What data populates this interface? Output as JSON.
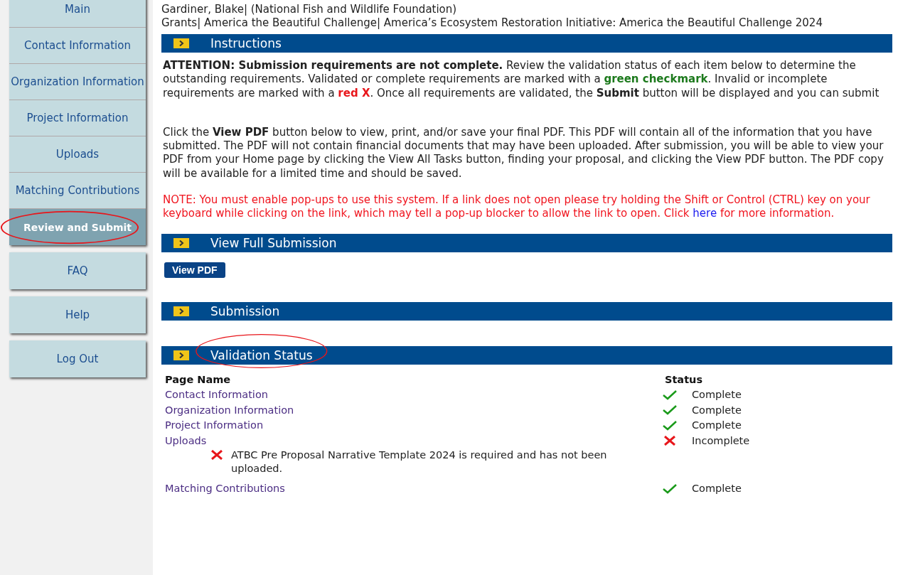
{
  "sidebar": {
    "groups": [
      {
        "items": [
          {
            "label": "Main",
            "selected": false,
            "circled": false
          },
          {
            "label": "Contact Information",
            "selected": false,
            "circled": false
          },
          {
            "label": "Organization Information",
            "selected": false,
            "circled": false
          },
          {
            "label": "Project Information",
            "selected": false,
            "circled": false
          },
          {
            "label": "Uploads",
            "selected": false,
            "circled": false
          },
          {
            "label": "Matching Contributions",
            "selected": false,
            "circled": false
          },
          {
            "label": "Review and Submit",
            "selected": true,
            "circled": true
          }
        ]
      },
      {
        "items": [
          {
            "label": "FAQ",
            "selected": false,
            "circled": false
          }
        ]
      },
      {
        "items": [
          {
            "label": "Help",
            "selected": false,
            "circled": false
          }
        ]
      },
      {
        "items": [
          {
            "label": "Log Out",
            "selected": false,
            "circled": false
          }
        ]
      }
    ]
  },
  "header_lines": [
    "Gardiner, Blake| (National Fish and Wildlife Foundation)",
    "Grants| America the Beautiful Challenge| America’s Ecosystem Restoration Initiative: America the Beautiful Challenge 2024"
  ],
  "sections": [
    {
      "title": "Instructions",
      "circled": false,
      "kind": "text",
      "paragraphs": [
        [
          {
            "kind": "bold",
            "text": "ATTENTION: Submission requirements are not complete."
          },
          {
            "kind": "text",
            "text": " Review the validation status of each item below to determine the outstanding requirements. Validated or complete requirements are marked with a "
          },
          {
            "kind": "green",
            "text": "green checkmark"
          },
          {
            "kind": "text",
            "text": ". Invalid or incomplete requirements are marked with a "
          },
          {
            "kind": "red",
            "text": "red X"
          },
          {
            "kind": "text",
            "text": ".  Once all requirements are validated, the "
          },
          {
            "kind": "bold",
            "text": "Submit"
          },
          {
            "kind": "text",
            "text": " button will be displayed and you can submit"
          }
        ],
        [
          {
            "kind": "text",
            "text": "Click the "
          },
          {
            "kind": "bold",
            "text": "View PDF"
          },
          {
            "kind": "text",
            "text": " button below to view, print, and/or save your final PDF. This PDF will contain all of the information that you have submitted. The PDF will not contain financial documents that may have been uploaded. After submission, you will be able to view your PDF from your Home page by clicking the View All Tasks button, finding your proposal, and clicking the View PDF button. The PDF copy will be available for a limited time and should be saved."
          }
        ],
        [
          {
            "kind": "warn",
            "text": "NOTE: You must enable pop-ups to use this system. If a link does not open please try holding the Shift or Control (CTRL) key on your keyboard while clicking on the link, which may tell a pop-up blocker to allow the link to open. Click "
          },
          {
            "kind": "link",
            "text": "here"
          },
          {
            "kind": "warn",
            "text": " for more information."
          }
        ]
      ]
    },
    {
      "title": "View Full Submission",
      "circled": false,
      "kind": "button",
      "button": "View PDF"
    },
    {
      "title": "Submission",
      "circled": false,
      "kind": "empty"
    },
    {
      "title": "Validation Status",
      "circled": true,
      "kind": "table",
      "columns": [
        "Page Name",
        "Status"
      ],
      "rows": [
        {
          "page": "Contact Information",
          "status": "Complete",
          "complete": true
        },
        {
          "page": "Organization Information",
          "status": "Complete",
          "complete": true
        },
        {
          "page": "Project Information",
          "status": "Complete",
          "complete": true
        },
        {
          "page": "Uploads",
          "status": "Incomplete",
          "complete": false,
          "issues": [
            "ATBC Pre Proposal Narrative Template 2024 is required and has not been uploaded."
          ]
        },
        {
          "page": "Matching Contributions",
          "status": "Complete",
          "complete": true
        }
      ]
    }
  ]
}
